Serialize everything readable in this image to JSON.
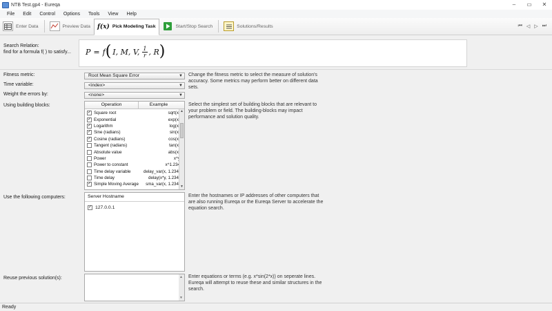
{
  "window": {
    "title": "NTB Test.gp4 - Eureqa",
    "minimize": "–",
    "maximize": "▭",
    "close": "✕"
  },
  "menu": [
    "File",
    "Edit",
    "Control",
    "Options",
    "Tools",
    "View",
    "Help"
  ],
  "toolbar": {
    "enter_data": "Enter Data",
    "preview_data": "Preview Data",
    "pick_task_icon": "f(x)",
    "pick_task": "Pick Modeling Task",
    "start_stop": "Start/Stop Search",
    "solutions": "Solutions/Results",
    "nav": [
      "⏮",
      "◁",
      "▷",
      "⏭"
    ]
  },
  "search_relation": {
    "label": "Search Relation:",
    "sublabel": "find for a formula f(  ) to satisfy...",
    "lhs": "P",
    "eq": "=",
    "func": "f",
    "args_before": "I, M, V,",
    "frac_num": "1",
    "frac_den": "r",
    "args_after": ", R"
  },
  "fitness": {
    "label": "Fitness metric:",
    "value": "Root Mean Square Error",
    "help": "Change the fitness metric to select the measure of solution's accuracy. Some metrics may perform better on different data sets."
  },
  "time_variable": {
    "label": "Time variable:",
    "value": "<index>"
  },
  "weight": {
    "label": "Weight the errors by:",
    "value": "<none>"
  },
  "building_blocks": {
    "label": "Using building blocks:",
    "col_operation": "Operation",
    "col_example": "Example",
    "help": "Select the simplest set of building blocks that are relevant to your problem or field. The building-blocks may impact performance and solution quality.",
    "rows": [
      {
        "name": "Square root",
        "example": "sqrt(x)",
        "check": "✓"
      },
      {
        "name": "Exponential",
        "example": "exp(x)",
        "check": "✓"
      },
      {
        "name": "Logarithm",
        "example": "log(x)",
        "check": "✓"
      },
      {
        "name": "Sine (radians)",
        "example": "sin(x)",
        "check": "✓"
      },
      {
        "name": "Cosine (radians)",
        "example": "cos(x)",
        "check": "✓"
      },
      {
        "name": "Tangent (radians)",
        "example": "tan(x)",
        "check": ""
      },
      {
        "name": "Absolute value",
        "example": "abs(x)",
        "check": ""
      },
      {
        "name": "Power",
        "example": "x^y",
        "check": ""
      },
      {
        "name": "Power to constant",
        "example": "x^1.234",
        "check": ""
      },
      {
        "name": "Time delay variable",
        "example": "delay_var(x, 1.234)",
        "check": ""
      },
      {
        "name": "Time delay",
        "example": "delay(x*y, 1.234)",
        "check": ""
      },
      {
        "name": "Simple Moving Average",
        "example": "sma_var(x, 1.234)",
        "check": "✓"
      }
    ]
  },
  "computers": {
    "label": "Use the following computers:",
    "col_host": "Server Hostname",
    "hosts": [
      {
        "name": "127.0.0.1",
        "check": "✓"
      }
    ],
    "help": "Enter the hostnames or IP addresses of other computers that are also running Eureqa or the Eureqa Server to accelerate the equation search."
  },
  "reuse": {
    "label": "Reuse previous solution(s):",
    "help": "Enter equations or terms (e.g. x*sin(2*x)) on seperate lines. Eureqa will attempt to reuse these and similar structures in the search."
  },
  "status": "Ready"
}
